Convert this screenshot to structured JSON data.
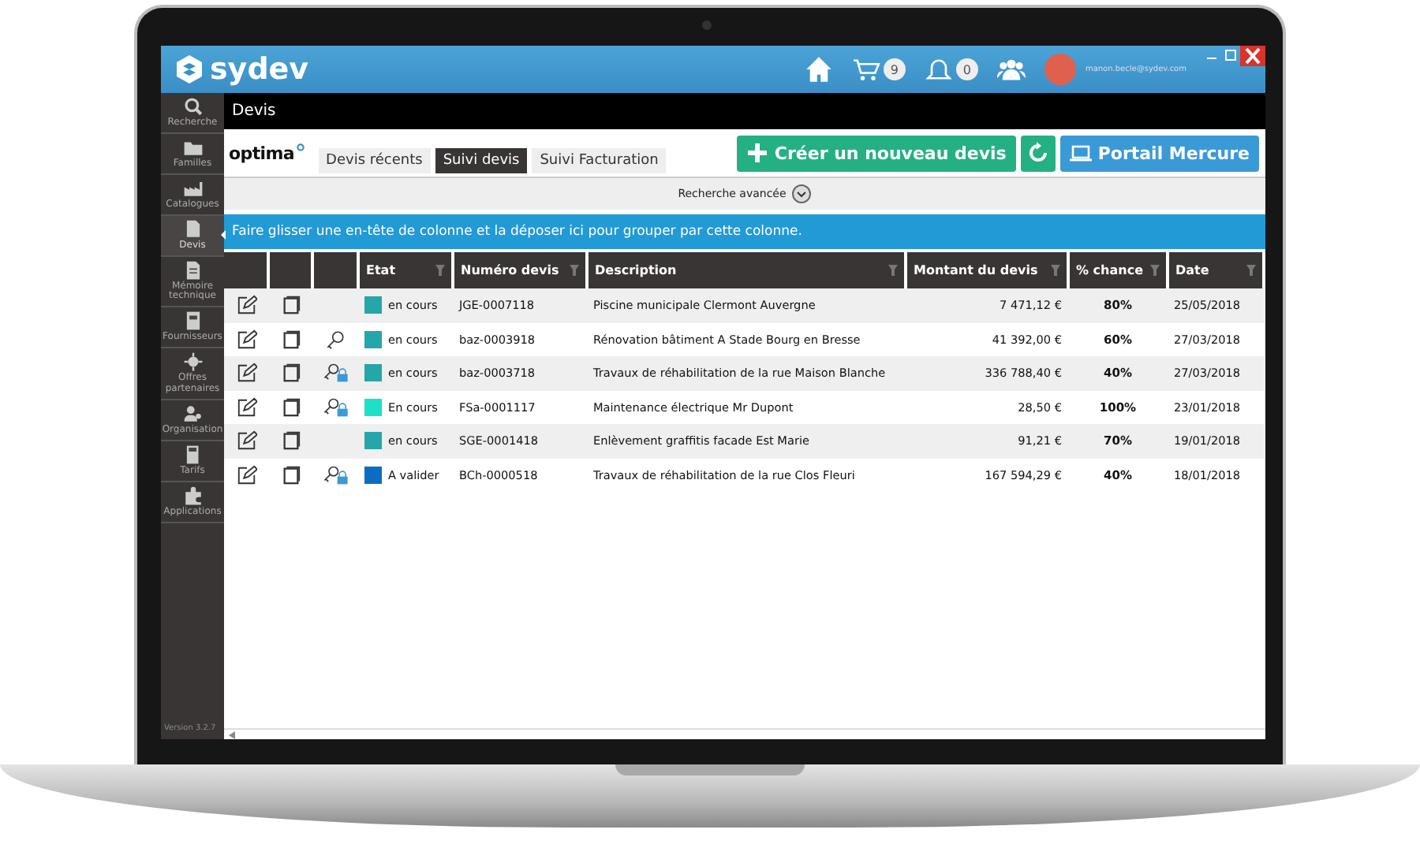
{
  "app": {
    "logo": "sydev",
    "email": "manon.becle@sydev.com",
    "cart_count": "9",
    "notification_count": "0"
  },
  "sidebar": {
    "items": [
      {
        "label": "Recherche",
        "selected": false
      },
      {
        "label": "Familles",
        "selected": false
      },
      {
        "label": "Catalogues",
        "selected": false
      },
      {
        "label": "Devis",
        "selected": true
      },
      {
        "label": "Mémoire technique",
        "selected": false
      },
      {
        "label": "Fournisseurs",
        "selected": false
      },
      {
        "label": "Offres partenaires",
        "selected": false
      },
      {
        "label": "Organisation",
        "selected": false
      },
      {
        "label": "Tarifs",
        "selected": false
      },
      {
        "label": "Applications",
        "selected": false
      }
    ],
    "version": "Version 3.2.7"
  },
  "page_title": "Devis",
  "toolbar": {
    "brand": "optima",
    "tabs": [
      {
        "label": "Devis récents",
        "selected": false
      },
      {
        "label": "Suivi devis",
        "selected": true
      },
      {
        "label": "Suivi Facturation",
        "selected": false
      }
    ],
    "buttons": [
      {
        "label": "Créer un nouveau devis",
        "kind": "create"
      },
      {
        "kind": "refresh"
      },
      {
        "label": "Portail Mercure",
        "kind": "portal"
      }
    ]
  },
  "advanced_search": {
    "label": "Recherche avancée"
  },
  "group_banner": "Faire glisser une en-tête de colonne et la déposer ici pour grouper par cette colonne.",
  "table": {
    "columns": [
      "Etat",
      "Numéro devis",
      "Description",
      "Montant du devis",
      "% chance",
      "Date"
    ],
    "rows": [
      {
        "kind": "plain",
        "color": "#26a6a8",
        "state": "en cours",
        "number": "JGE-0007118",
        "description": "Piscine municipale Clermont Auvergne",
        "amount": "7 471,12 €",
        "chance": "80%",
        "date": "25/05/2018"
      },
      {
        "kind": "key",
        "color": "#26a6a8",
        "state": "en cours",
        "number": "baz-0003918",
        "description": "Rénovation bâtiment A Stade Bourg en Bresse",
        "amount": "41 392,00 €",
        "chance": "60%",
        "date": "27/03/2018"
      },
      {
        "kind": "locked",
        "color": "#26a6a8",
        "state": "en cours",
        "number": "baz-0003718",
        "description": "Travaux de réhabilitation de la rue Maison Blanche",
        "amount": "336 788,40 €",
        "chance": "40%",
        "date": "27/03/2018"
      },
      {
        "kind": "locked",
        "color": "#1de0c8",
        "state": "En cours",
        "number": "FSa-0001117",
        "description": "Maintenance électrique Mr Dupont",
        "amount": "28,50 €",
        "chance": "100%",
        "date": "23/01/2018"
      },
      {
        "kind": "plain",
        "color": "#26a6a8",
        "state": "en cours",
        "number": "SGE-0001418",
        "description": "Enlèvement graffitis facade Est Marie",
        "amount": "91,21 €",
        "chance": "70%",
        "date": "19/01/2018"
      },
      {
        "kind": "locked",
        "color": "#0c6cc4",
        "state": "A valider",
        "number": "BCh-0000518",
        "description": "Travaux de réhabilitation de la rue Clos Fleuri",
        "amount": "167 594,29 €",
        "chance": "40%",
        "date": "18/01/2018"
      }
    ]
  }
}
